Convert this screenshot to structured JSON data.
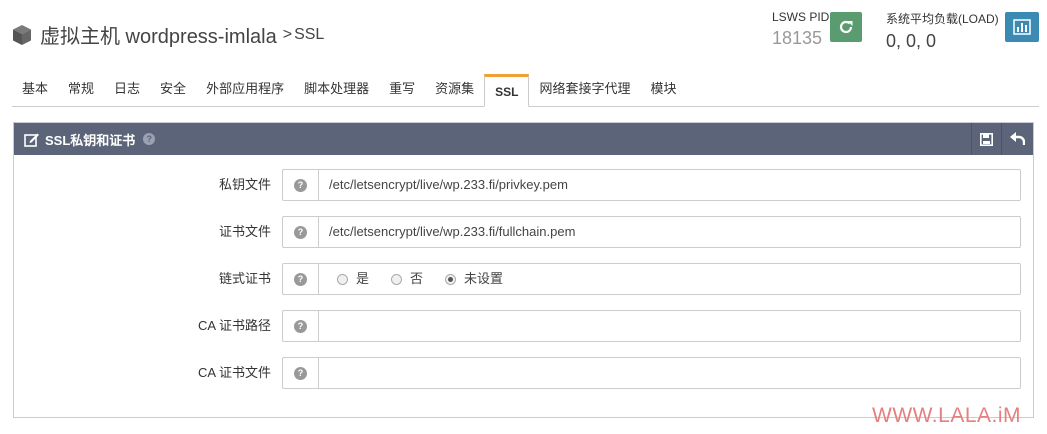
{
  "header": {
    "title": "虚拟主机 wordpress-imlala",
    "separator": ">",
    "subtitle": "SSL",
    "pid_label": "LSWS PID",
    "pid_value": "18135",
    "load_label": "系统平均负载(LOAD)",
    "load_value": "0, 0, 0"
  },
  "tabs": [
    {
      "label": "基本"
    },
    {
      "label": "常规"
    },
    {
      "label": "日志"
    },
    {
      "label": "安全"
    },
    {
      "label": "外部应用程序"
    },
    {
      "label": "脚本处理器"
    },
    {
      "label": "重写"
    },
    {
      "label": "资源集"
    },
    {
      "label": "SSL",
      "active": true
    },
    {
      "label": "网络套接字代理"
    },
    {
      "label": "模块"
    }
  ],
  "panel": {
    "title": "SSL私钥和证书",
    "rows": [
      {
        "label": "私钥文件",
        "value": "/etc/letsencrypt/live/wp.233.fi/privkey.pem"
      },
      {
        "label": "证书文件",
        "value": "/etc/letsencrypt/live/wp.233.fi/fullchain.pem"
      },
      {
        "label": "链式证书",
        "options": [
          "是",
          "否",
          "未设置"
        ],
        "selected": "未设置"
      },
      {
        "label": "CA 证书路径",
        "value": ""
      },
      {
        "label": "CA 证书文件",
        "value": ""
      }
    ]
  },
  "watermark": "WWW.LALA.iM",
  "colors": {
    "accent_tab": "#f0a030",
    "panel_header": "#5b6479",
    "restart_button": "#5a9b6f",
    "stats_button": "#3b8ab4",
    "watermark": "#e67f7f"
  },
  "icons": {
    "title": "cube-icon",
    "restart": "refresh-icon",
    "stats": "bar-chart-icon",
    "panel_title": "edit-icon",
    "save": "save-icon",
    "undo": "undo-icon",
    "help": "question-icon"
  }
}
